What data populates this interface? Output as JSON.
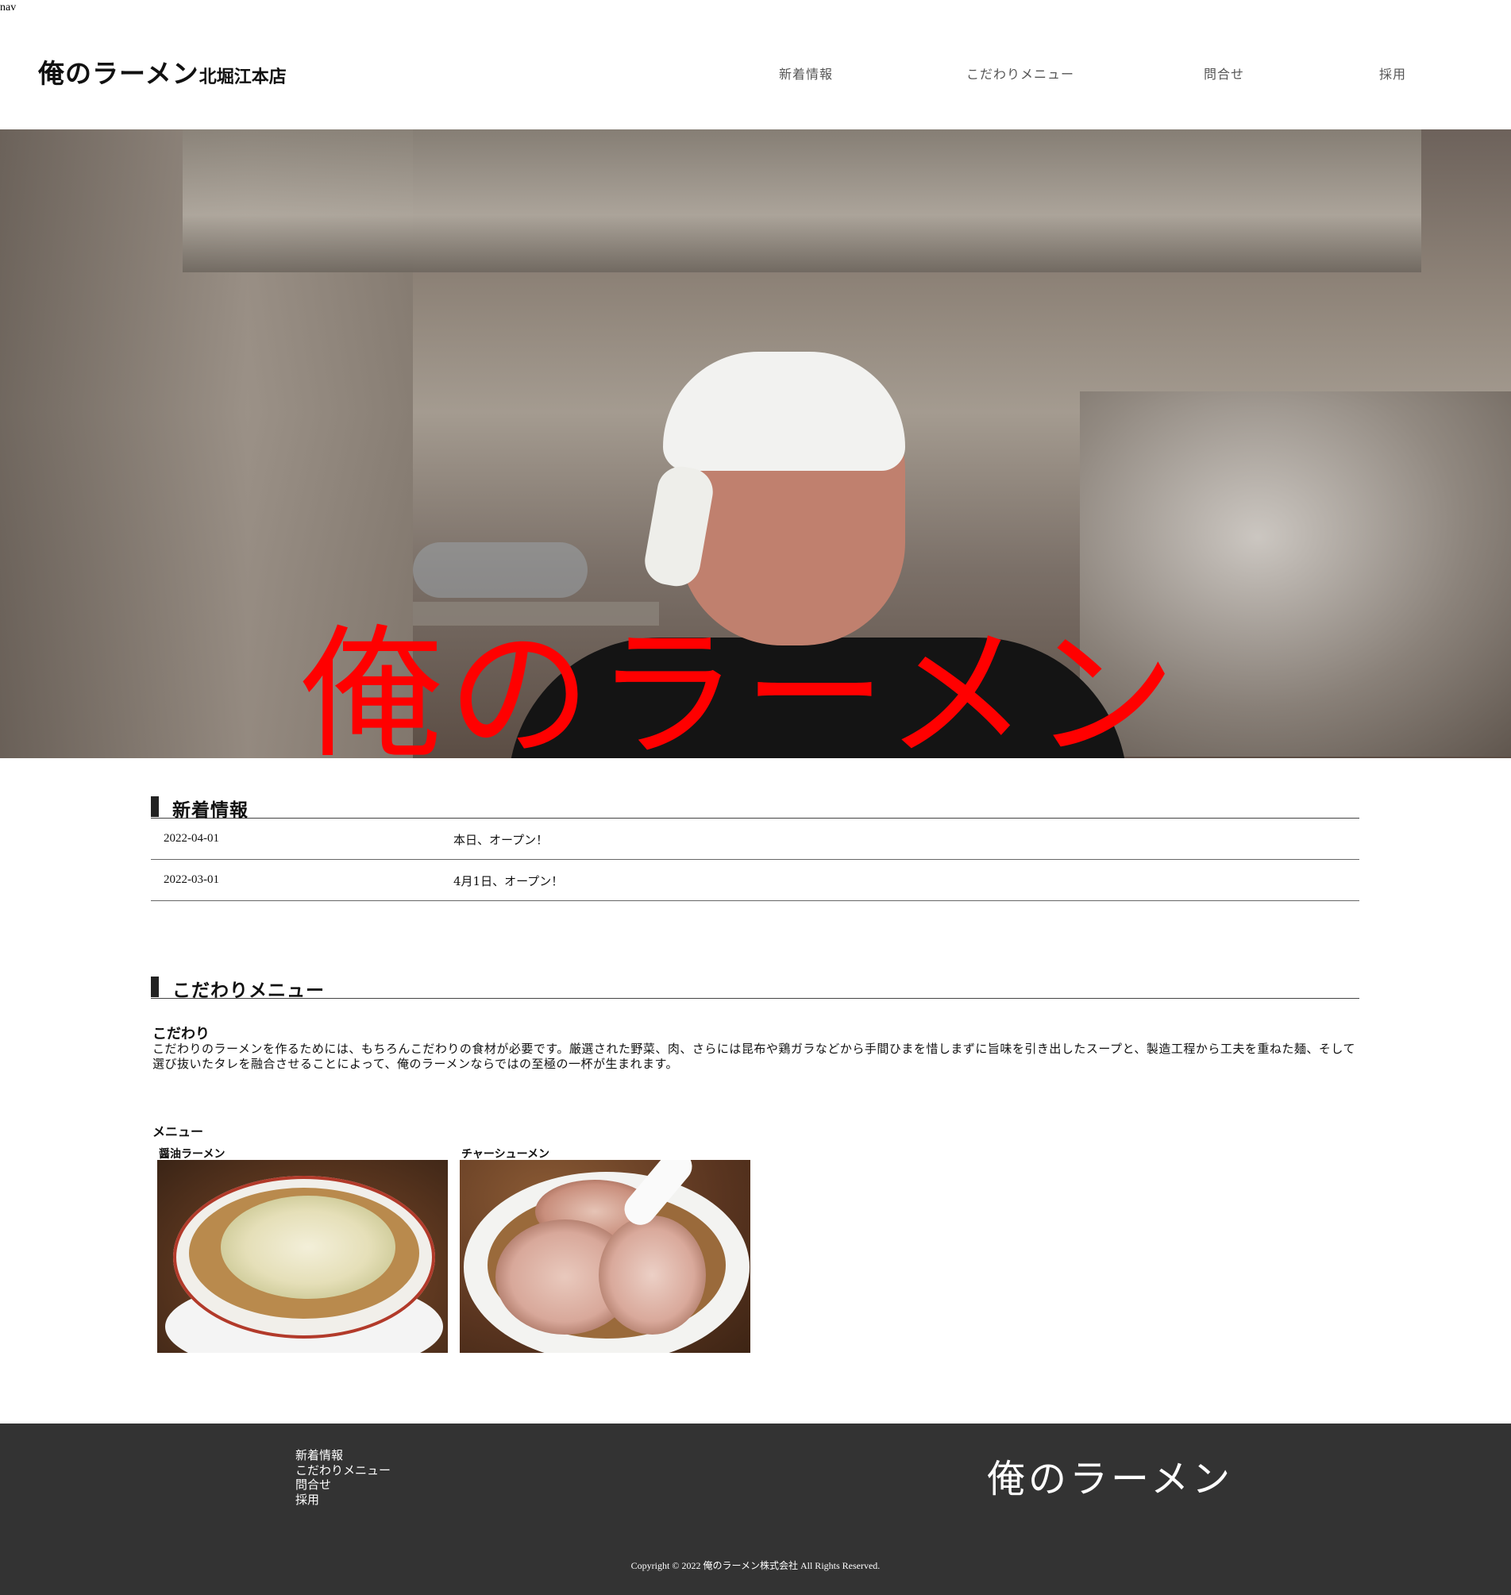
{
  "debug_tag": "nav",
  "header": {
    "brand": "俺のラーメン",
    "branch": "北堀江本店",
    "nav": [
      {
        "label": "新着情報"
      },
      {
        "label": "こだわりメニュー"
      },
      {
        "label": "問合せ"
      },
      {
        "label": "採用"
      }
    ]
  },
  "hero": {
    "title": "俺のラーメン"
  },
  "news": {
    "heading": "新着情報",
    "items": [
      {
        "date": "2022-04-01",
        "text": "本日、オープン！"
      },
      {
        "date": "2022-03-01",
        "text": "4月1日、オープン！"
      }
    ]
  },
  "kodawari": {
    "heading": "こだわりメニュー",
    "subheading": "こだわり",
    "body": "こだわりのラーメンを作るためには、もちろんこだわりの食材が必要です。厳選された野菜、肉、さらには昆布や鶏ガラなどから手間ひまを惜しまずに旨味を引き出したスープと、製造工程から工夫を重ねた麺、そして選び抜いたタレを融合させることによって、俺のラーメンならではの至極の一杯が生まれます。",
    "menu_label": "メニュー",
    "menu_items": [
      {
        "name": "醤油ラーメン"
      },
      {
        "name": "チャーシューメン"
      }
    ]
  },
  "footer": {
    "links": [
      {
        "label": "新着情報"
      },
      {
        "label": "こだわりメニュー"
      },
      {
        "label": "問合せ"
      },
      {
        "label": "採用"
      }
    ],
    "logo": "俺のラーメン",
    "copyright": "Copyright © 2022 俺のラーメン株式会社 All Rights Reserved."
  },
  "colors": {
    "hero_title": "#ff0000",
    "footer_bg": "#333333",
    "nav_text": "#555555"
  }
}
